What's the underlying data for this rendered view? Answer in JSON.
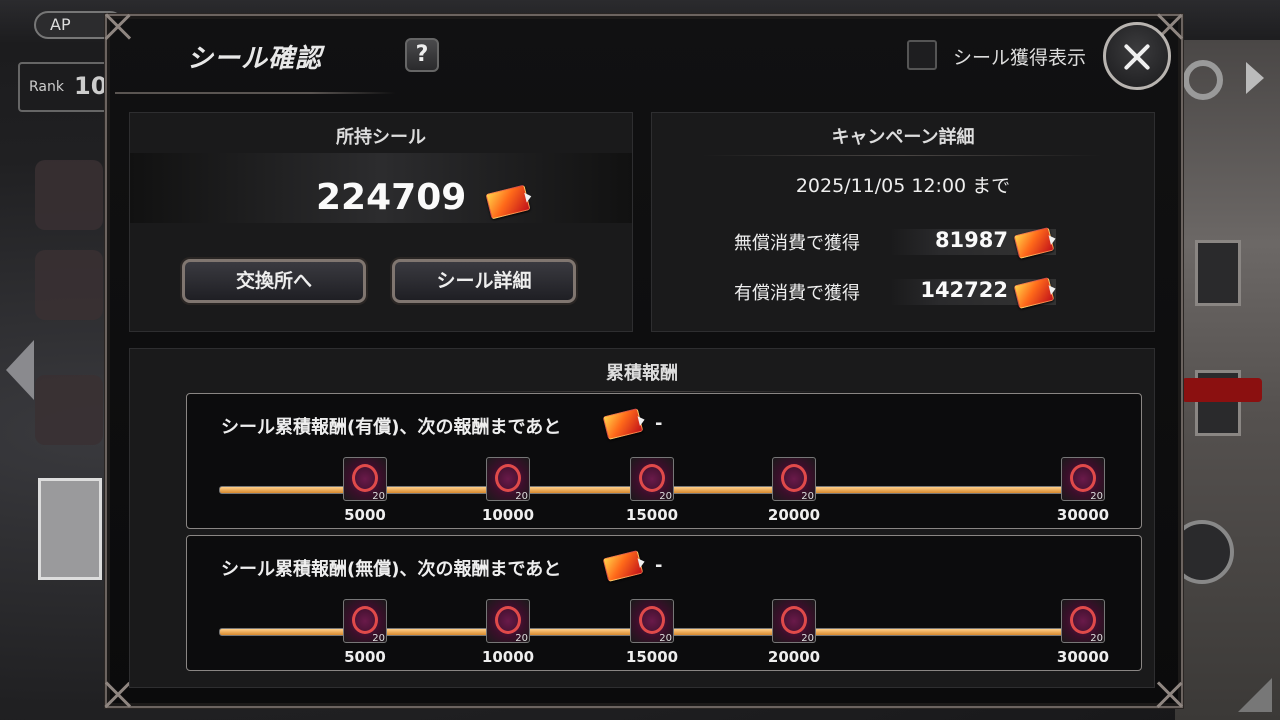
{
  "background": {
    "ap_label": "AP",
    "rank_label": "Rank",
    "rank_value": "10"
  },
  "dialog": {
    "title": "シール確認",
    "help_label": "?",
    "show_acquired_label": "シール獲得表示",
    "owned": {
      "heading": "所持シール",
      "count": "224709",
      "exchange_button": "交換所へ",
      "detail_button": "シール詳細"
    },
    "campaign": {
      "heading": "キャンペーン詳細",
      "deadline": "2025/11/05 12:00 まで",
      "rows": [
        {
          "label": "無償消費で獲得",
          "value": "81987"
        },
        {
          "label": "有償消費で獲得",
          "value": "142722"
        }
      ]
    },
    "cumulative": {
      "heading": "累積報酬",
      "tracks": [
        {
          "title": "シール累積報酬(有償)、次の報酬まであと",
          "remaining": "-",
          "milestones": [
            {
              "threshold": "5000",
              "reward_qty": "20"
            },
            {
              "threshold": "10000",
              "reward_qty": "20"
            },
            {
              "threshold": "15000",
              "reward_qty": "20"
            },
            {
              "threshold": "20000",
              "reward_qty": "20"
            },
            {
              "threshold": "30000",
              "reward_qty": "20"
            }
          ]
        },
        {
          "title": "シール累積報酬(無償)、次の報酬まであと",
          "remaining": "-",
          "milestones": [
            {
              "threshold": "5000",
              "reward_qty": "20"
            },
            {
              "threshold": "10000",
              "reward_qty": "20"
            },
            {
              "threshold": "15000",
              "reward_qty": "20"
            },
            {
              "threshold": "20000",
              "reward_qty": "20"
            },
            {
              "threshold": "30000",
              "reward_qty": "20"
            }
          ]
        }
      ]
    }
  },
  "colors": {
    "accent_orange": "#d88a2e",
    "ticket_red": "#c0101a",
    "frame": "#807670"
  }
}
